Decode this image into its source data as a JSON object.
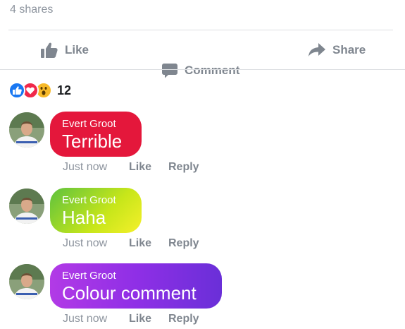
{
  "post": {
    "shares_text": "4 shares"
  },
  "actions": {
    "like_label": "Like",
    "comment_label": "Comment",
    "share_label": "Share",
    "icon_color": "#7f868f"
  },
  "reactions": {
    "icons": [
      "like-icon",
      "love-icon",
      "wow-icon"
    ],
    "count": "12"
  },
  "comments": [
    {
      "author": "Evert Groot",
      "text": "Terrible",
      "time": "Just now",
      "like_label": "Like",
      "reply_label": "Reply",
      "bubble_color": "#e4173b"
    },
    {
      "author": "Evert Groot",
      "text": "Haha",
      "time": "Just now",
      "like_label": "Like",
      "reply_label": "Reply",
      "bubble_color": "green-yellow gradient"
    },
    {
      "author": "Evert Groot",
      "text": "Colour comment",
      "time": "Just now",
      "like_label": "Like",
      "reply_label": "Reply",
      "bubble_color": "purple gradient"
    }
  ]
}
